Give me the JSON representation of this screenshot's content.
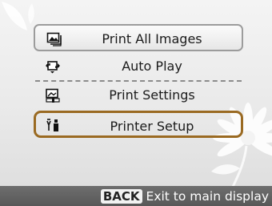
{
  "menu": {
    "items": [
      {
        "label": "Print All Images",
        "icon": "print-all-images-icon",
        "state": "highlighted"
      },
      {
        "label": "Auto Play",
        "icon": "auto-play-icon"
      },
      {
        "label": "Print Settings",
        "icon": "print-settings-icon"
      },
      {
        "label": "Printer Setup",
        "icon": "printer-setup-icon",
        "state": "selected"
      }
    ]
  },
  "footer": {
    "key_label": "BACK",
    "hint": "Exit to main display"
  },
  "colors": {
    "selection_border": "#9a6a22",
    "footer_bg": "#636363"
  }
}
